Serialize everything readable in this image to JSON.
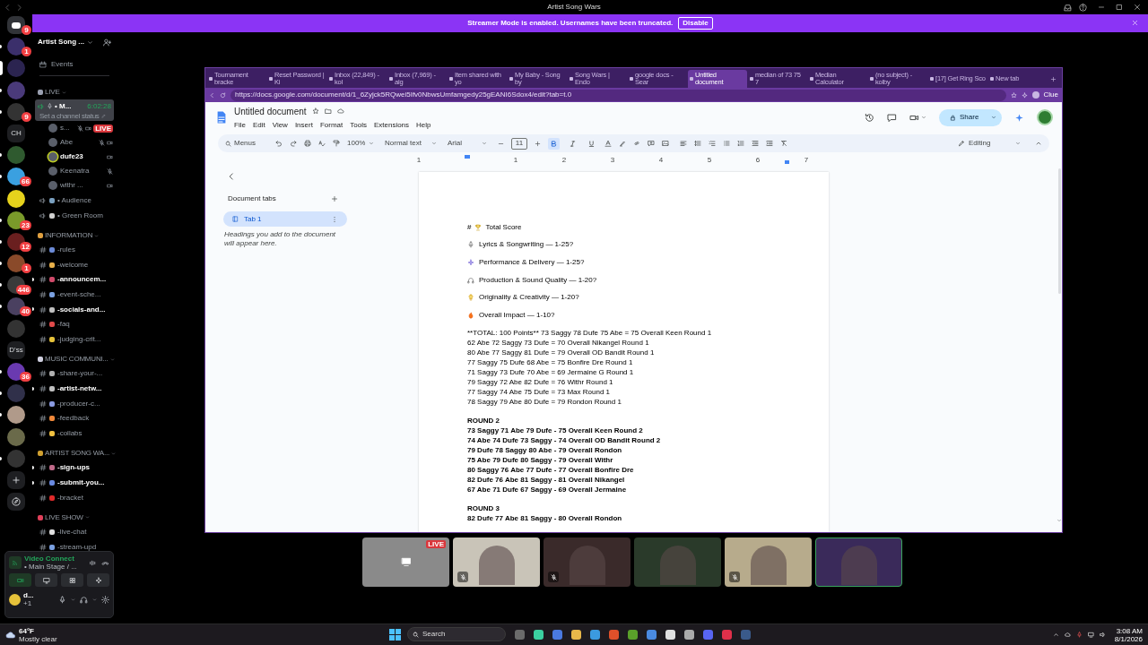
{
  "titlebar": {
    "title": "Artist Song Wars"
  },
  "banner": {
    "text": "Streamer Mode is enabled. Usernames have been truncated.",
    "button": "Disable"
  },
  "servers": [
    {
      "kind": "app",
      "badge": "9",
      "unread": false,
      "selected": false
    },
    {
      "kind": "avatar",
      "badge": "1",
      "unread": true,
      "selected": false
    },
    {
      "kind": "avatar",
      "unread": false,
      "selected": true
    },
    {
      "kind": "avatar",
      "unread": true,
      "selected": false
    },
    {
      "kind": "avatar",
      "badge": "9",
      "unread": true,
      "selected": false
    },
    {
      "kind": "text",
      "label": "CH",
      "unread": false,
      "selected": false
    },
    {
      "kind": "avatar",
      "unread": true,
      "selected": false
    },
    {
      "kind": "avatar",
      "badge": "66",
      "unread": true,
      "selected": false
    },
    {
      "kind": "avatar",
      "unread": false,
      "selected": false
    },
    {
      "kind": "avatar",
      "badge": "23",
      "unread": true,
      "selected": false
    },
    {
      "kind": "avatar",
      "badge": "12",
      "unread": true,
      "selected": false
    },
    {
      "kind": "avatar",
      "badge": "1",
      "unread": true,
      "selected": false
    },
    {
      "kind": "avatar",
      "badge": "446",
      "unread": true,
      "selected": false
    },
    {
      "kind": "avatar",
      "badge": "40",
      "unread": true,
      "selected": false
    },
    {
      "kind": "avatar",
      "unread": false,
      "selected": false
    },
    {
      "kind": "text",
      "label": "D'ss",
      "unread": false,
      "selected": false
    },
    {
      "kind": "avatar",
      "badge": "36",
      "unread": true,
      "selected": false
    },
    {
      "kind": "avatar",
      "unread": true,
      "selected": false
    },
    {
      "kind": "avatar",
      "unread": true,
      "selected": false
    },
    {
      "kind": "avatar",
      "unread": false,
      "selected": false
    },
    {
      "kind": "avatar",
      "unread": true,
      "selected": false
    },
    {
      "kind": "add",
      "unread": false,
      "selected": false
    },
    {
      "kind": "explore",
      "unread": false,
      "selected": false
    }
  ],
  "channel_list": {
    "server_name": "Artist Song ...",
    "events": "Events",
    "categories": [
      {
        "title": "LIVE",
        "channels": [
          {
            "kind": "stage",
            "name": "• M...",
            "timer": "6:02:28",
            "status": "Set a channel status",
            "selected": true,
            "members": [
              {
                "name": "s...",
                "muted": true,
                "video": true,
                "speaking": false,
                "badge": "LIVE"
              },
              {
                "name": "Abe",
                "muted": true,
                "video": true,
                "speaking": false
              },
              {
                "name": "dufe23",
                "muted": false,
                "video": true,
                "speaking": true
              },
              {
                "name": "Keenatra",
                "muted": true,
                "video": false,
                "speaking": false
              },
              {
                "name": "withr ...",
                "muted": false,
                "video": true,
                "speaking": false
              }
            ]
          },
          {
            "kind": "voice",
            "name": "• Audience",
            "selected": false,
            "unread": false
          },
          {
            "kind": "voice",
            "name": "• Green Room",
            "selected": false,
            "unread": false
          }
        ]
      },
      {
        "title": "INFORMATION",
        "channels": [
          {
            "kind": "text",
            "name": "-rules",
            "selected": false,
            "unread": false
          },
          {
            "kind": "text",
            "name": "-welcome",
            "selected": false,
            "unread": false
          },
          {
            "kind": "text",
            "name": "-announcem...",
            "selected": false,
            "unread": true
          },
          {
            "kind": "text",
            "name": "-event-sche...",
            "selected": false,
            "unread": false
          },
          {
            "kind": "text",
            "name": "-socials-and...",
            "selected": false,
            "unread": true
          },
          {
            "kind": "text",
            "name": "-faq",
            "selected": false,
            "unread": false
          },
          {
            "kind": "text",
            "name": "-judging-crit...",
            "selected": false,
            "unread": false
          }
        ]
      },
      {
        "title": "MUSIC COMMUNI...",
        "channels": [
          {
            "kind": "text",
            "name": "-share-your-...",
            "selected": false,
            "unread": false
          },
          {
            "kind": "text",
            "name": "-artist-netw...",
            "selected": false,
            "unread": true
          },
          {
            "kind": "text",
            "name": "-producer-c...",
            "selected": false,
            "unread": false
          },
          {
            "kind": "text",
            "name": "-feedback",
            "selected": false,
            "unread": false
          },
          {
            "kind": "text",
            "name": "-collabs",
            "selected": false,
            "unread": false
          }
        ]
      },
      {
        "title": "ARTIST SONG WA...",
        "channels": [
          {
            "kind": "text",
            "name": "-sign-ups",
            "selected": false,
            "unread": true
          },
          {
            "kind": "text",
            "name": "-submit-you...",
            "selected": false,
            "unread": true
          },
          {
            "kind": "text",
            "name": "-bracket",
            "selected": false,
            "unread": false
          }
        ]
      },
      {
        "title": "LIVE SHOW",
        "channels": [
          {
            "kind": "text",
            "name": "-live-chat",
            "selected": false,
            "unread": false
          },
          {
            "kind": "text",
            "name": "-stream-upd",
            "selected": false,
            "unread": false
          }
        ]
      }
    ]
  },
  "voice_panel": {
    "title": "Video Connect",
    "channel": "• Main Stage / ...",
    "user": "d...",
    "user_status": "+1"
  },
  "browser": {
    "tabs": [
      {
        "title": "Tournament bracke",
        "selected": false
      },
      {
        "title": "Reset Password | Ki",
        "selected": false
      },
      {
        "title": "Inbox (22,849) - kol",
        "selected": false
      },
      {
        "title": "Inbox (7,969) - alg",
        "selected": false
      },
      {
        "title": "Item shared with yo",
        "selected": false
      },
      {
        "title": "My Baby - Song by",
        "selected": false
      },
      {
        "title": "Song Wars | Endo",
        "selected": false
      },
      {
        "title": "google docs - Sear",
        "selected": false
      },
      {
        "title": "Untitled document",
        "selected": true
      },
      {
        "title": "median of 73 75 7",
        "selected": false
      },
      {
        "title": "Median Calculator",
        "selected": false
      },
      {
        "title": "(no subject) - kolby",
        "selected": false
      },
      {
        "title": "[17] Get Ring Sco",
        "selected": false
      },
      {
        "title": "New tab",
        "selected": false
      }
    ],
    "url": "https://docs.google.com/document/d/1_6Zyjck5RQwei5Ifv0NbwsUmfamgedy25gEANI6Sdox4/edit?tab=t.0",
    "profile": "Clue"
  },
  "docs": {
    "title": "Untitled document",
    "menu": [
      "File",
      "Edit",
      "View",
      "Insert",
      "Format",
      "Tools",
      "Extensions",
      "Help"
    ],
    "share": "Share",
    "toolbar": {
      "search": "Menus",
      "zoom": "100%",
      "style": "Normal text",
      "font": "Arial",
      "font_size": "11",
      "bold": true,
      "italic": false,
      "underline": false,
      "mode": "Editing"
    },
    "ruler": [
      "1",
      "1",
      "2",
      "3",
      "4",
      "5",
      "6",
      "7"
    ],
    "outline": {
      "title": "Document tabs",
      "tabs": [
        {
          "label": "Tab 1",
          "selected": true
        }
      ],
      "hint": "Headings you add to the document will appear here."
    },
    "blocks": [
      {
        "kind": "heading",
        "prefix": "#",
        "text": "Total Score"
      },
      {
        "kind": "criterion",
        "text": "Lyrics & Songwriting —  1-25?"
      },
      {
        "kind": "criterion",
        "text": "Performance & Delivery —  1-25?"
      },
      {
        "kind": "criterion",
        "text": "Production & Sound Quality — 1-20?"
      },
      {
        "kind": "criterion",
        "text": "Originality & Creativity — 1-20?"
      },
      {
        "kind": "criterion",
        "text": "Overall Impact — 1-10?"
      },
      {
        "kind": "paragraph",
        "bold": false,
        "lines": [
          "**TOTAL: 100 Points** 73 Saggy 78 Dufe 75 Abe = 75 Overall Keen Round 1",
          "62 Abe 72 Saggy 73 Dufe = 70 Overall Nikangel Round 1",
          "80 Abe 77 Saggy 81 Dufe = 79 Overall OD Bandit Round 1",
          "77 Saggy 75 Dufe 68 Abe = 75 Bonfire Dre Round 1",
          "71 Saggy 73 Dufe 70 Abe = 69 Jermaine G Round 1",
          "79 Saggy 72 Abe 82 Dufe = 76 Withr Round 1",
          "77 Saggy 74 Abe 75 Dufe = 73 Max Round 1",
          "78 Saggy 79 Abe 80 Dufe = 79 Rondon Round 1"
        ]
      },
      {
        "kind": "paragraph",
        "bold": true,
        "lines": [
          "ROUND 2",
          "73 Saggy 71 Abe 79 Dufe - 75 Overall Keen Round 2",
          "74 Abe 74 Dufe 73 Saggy - 74 Overall OD Bandit Round 2",
          "79 Dufe 78 Saggy 80 Abe - 79 Overall Rondon",
          "75 Abe 79 Dufe 80 Saggy - 79 Overall Withr",
          "80 Saggy 76 Abe 77 Dufe - 77 Overall Bonfire Dre",
          "82 Dufe 76 Abe 81 Saggy - 81 Overall Nikangel",
          "67 Abe 71 Dufe 67 Saggy - 69 Overall Jermaine"
        ]
      },
      {
        "kind": "paragraph",
        "bold": true,
        "lines": [
          "ROUND 3",
          "82 Dufe 77 Abe 81 Saggy - 80 Overall Rondon"
        ]
      }
    ]
  },
  "participants": [
    {
      "kind": "screen",
      "muted": false,
      "selected": false,
      "badge": "LIVE"
    },
    {
      "kind": "camera",
      "muted": true,
      "selected": false
    },
    {
      "kind": "camera",
      "muted": true,
      "selected": false
    },
    {
      "kind": "camera",
      "muted": false,
      "selected": false
    },
    {
      "kind": "camera",
      "muted": true,
      "selected": false
    },
    {
      "kind": "camera",
      "muted": false,
      "selected": true
    }
  ],
  "taskbar": {
    "weather": {
      "temp": "64°F",
      "condition": "Mostly clear"
    },
    "search": "Search",
    "time": "3:08 AM",
    "date": "8/1/2026"
  }
}
